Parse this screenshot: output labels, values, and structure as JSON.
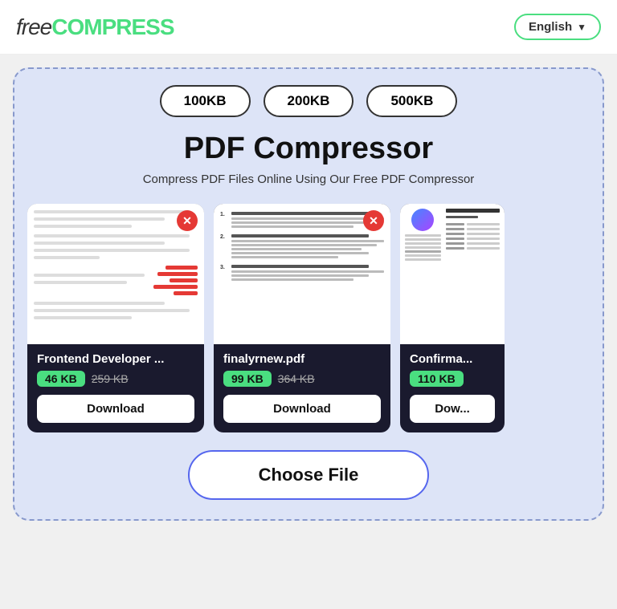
{
  "header": {
    "logo_free": "free",
    "logo_compress": "COMPRESS",
    "lang_label": "English",
    "lang_chevron": "▼"
  },
  "compressor": {
    "size_btns": [
      "100KB",
      "200KB",
      "500KB"
    ],
    "title": "PDF Compressor",
    "subtitle": "Compress PDF Files Online Using Our Free PDF Compressor",
    "files": [
      {
        "name": "Frontend Developer ...",
        "size_new": "46 KB",
        "size_old": "259 KB",
        "download_label": "Download",
        "has_close": true
      },
      {
        "name": "finalyrnew.pdf",
        "size_new": "99 KB",
        "size_old": "364 KB",
        "download_label": "Download",
        "has_close": true
      },
      {
        "name": "Confirma...",
        "size_new": "110 KB",
        "size_old": "",
        "download_label": "Dow...",
        "has_close": false
      }
    ],
    "choose_file_label": "Choose File"
  }
}
